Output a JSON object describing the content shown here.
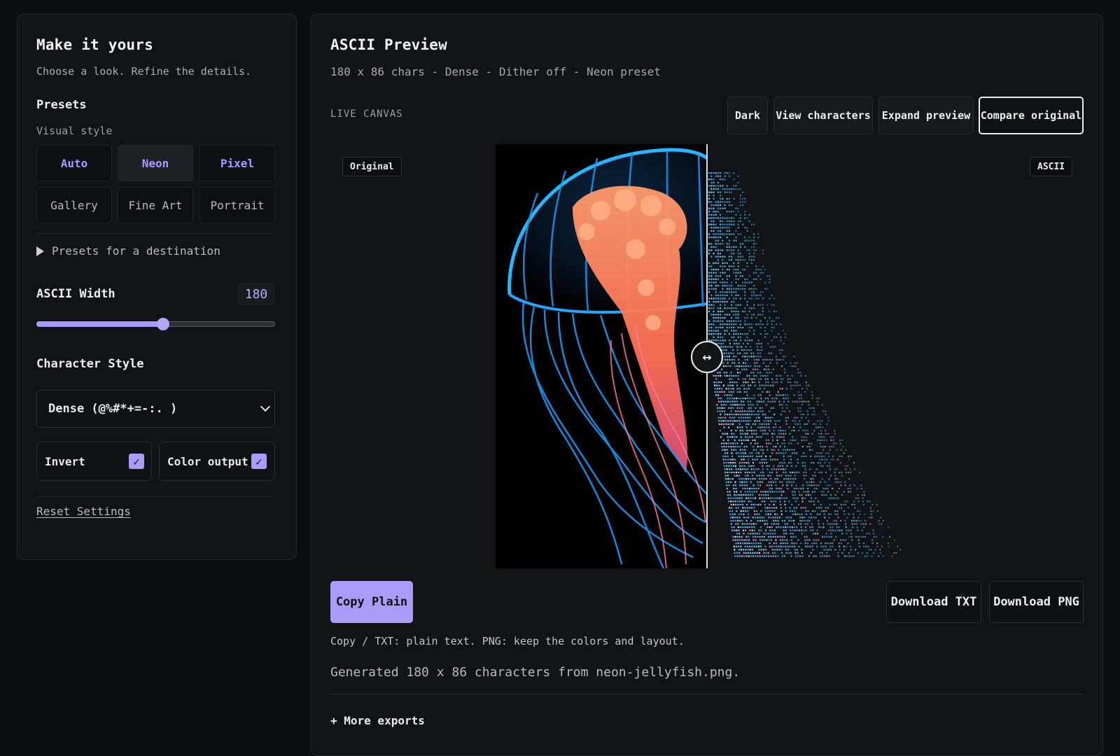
{
  "left": {
    "title": "Make it yours",
    "subtitle": "Choose a look. Refine the details.",
    "presets_heading": "Presets",
    "visual_style_label": "Visual style",
    "presets": [
      "Auto",
      "Neon",
      "Pixel",
      "Gallery",
      "Fine Art",
      "Portrait"
    ],
    "selected_preset": "Neon",
    "destination_toggle": "Presets for a destination",
    "width_label": "ASCII Width",
    "width_value": "180",
    "width_fraction": 0.53,
    "char_style_label": "Character Style",
    "char_style_value": "Dense (@%#*+=-:. )",
    "invert_label": "Invert",
    "invert_checked": true,
    "color_output_label": "Color output",
    "color_output_checked": true,
    "reset_label": "Reset Settings"
  },
  "right": {
    "title": "ASCII Preview",
    "meta": "180 x 86 chars - Dense - Dither off - Neon preset",
    "live_canvas_label": "LIVE CANVAS",
    "toolbar": [
      "Dark",
      "View characters",
      "Expand preview",
      "Compare original"
    ],
    "active_toolbar": "Compare original",
    "original_tag": "Original",
    "ascii_tag": "ASCII",
    "copy_button": "Copy Plain",
    "download_txt": "Download TXT",
    "download_png": "Download PNG",
    "export_note": "Copy / TXT: plain text. PNG: keep the colors and layout.",
    "generated_text": "Generated 180 x 86 characters from neon-jellyfish.png.",
    "more_exports": "+ More exports"
  },
  "colors": {
    "accent": "#a99cf8",
    "background": "#0b0f11",
    "panel": "#101416"
  }
}
